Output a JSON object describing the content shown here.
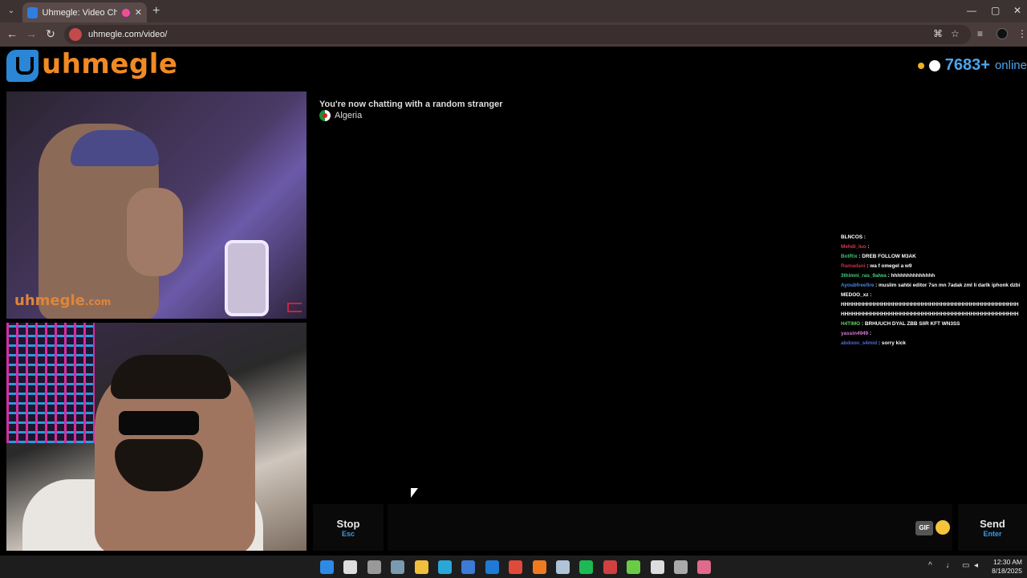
{
  "browser": {
    "tab_title": "Uhmegle: Video Chat | Ome",
    "tab_close": "✕",
    "new_tab": "+",
    "url": "uhmegle.com/video/",
    "window_controls": [
      "—",
      "▢",
      "✕"
    ]
  },
  "header": {
    "logo_text": "uhmegle",
    "online_count": "7683+",
    "online_label": "online"
  },
  "video": {
    "watermark": "uhmegle",
    "watermark_suffix": ".com"
  },
  "chat": {
    "status": "You're now chatting with a random stranger",
    "country": "Algeria",
    "stream_messages": [
      {
        "user": "BLNCOS",
        "text": " : ",
        "color": "#ffffff"
      },
      {
        "user": "Mehdi_luo",
        "text": " : ",
        "color": "#e0334a"
      },
      {
        "user": "BotRix",
        "text": " : DREB FOLLOW M3AK",
        "color": "#38c56a"
      },
      {
        "user": "Ramadani",
        "text": " : wa f omegel a w9",
        "color": "#c03040"
      },
      {
        "user": "3thimni_ras_9alwa",
        "text": " : hhhhhhhhhhhhhh",
        "color": "#3fd07a"
      },
      {
        "user": "Ayoubfreefire",
        "text": " : muslim sahbi editor 7sn mn 7adak zml li darlk iphonk dzbi",
        "color": "#4a86e0"
      },
      {
        "user": "MEDOO_xz",
        "text": " :",
        "color": "#ffffff"
      },
      {
        "user": "",
        "text": "HHHHHHHHHHHHHHHHHHHHHHHHHHHHHHHHHHHHHHHHHHHHHHHH",
        "color": "#ffffff"
      },
      {
        "user": "",
        "text": "HHHHHHHHHHHHHHHHHHHHHHHHHHHHHHHHHHHHHHHHHHHHHHHH",
        "color": "#ffffff"
      },
      {
        "user": "H4TIMO",
        "text": " : BRHUUCH DYAL ZBB SIIR KFT WN3SS",
        "color": "#5fd060"
      },
      {
        "user": "yassin4949",
        "text": " : ",
        "color": "#d67ad0"
      },
      {
        "user": "abdooo_s4mid",
        "text": " : sorry kick",
        "color": "#4a70d0"
      }
    ]
  },
  "controls": {
    "stop_label": "Stop",
    "stop_key": "Esc",
    "send_label": "Send",
    "send_key": "Enter",
    "gif_label": "GIF"
  },
  "taskbar": {
    "time": "12:30 AM",
    "date": "8/18/2025",
    "apps": [
      "start-icon",
      "search-icon",
      "task-view-icon",
      "settings-icon",
      "file-explorer-icon",
      "edge-icon",
      "store-icon",
      "outlook-icon",
      "chrome-icon",
      "app-a-icon",
      "steam-icon",
      "spotify-icon",
      "app-red-icon",
      "media-icon",
      "app-tray-icon",
      "app-mon-icon",
      "screen-capture-icon"
    ],
    "app_colors": [
      "#2e8ae6",
      "#dddddd",
      "#999999",
      "#7a9ab0",
      "#f0c03c",
      "#2aa7d8",
      "#3c7ad6",
      "#1f7ad6",
      "#e04a3a",
      "#f07a20",
      "#b0c4d8",
      "#1db954",
      "#d04040",
      "#6acc44",
      "#dddddd",
      "#aaaaaa",
      "#e06a8a"
    ]
  }
}
